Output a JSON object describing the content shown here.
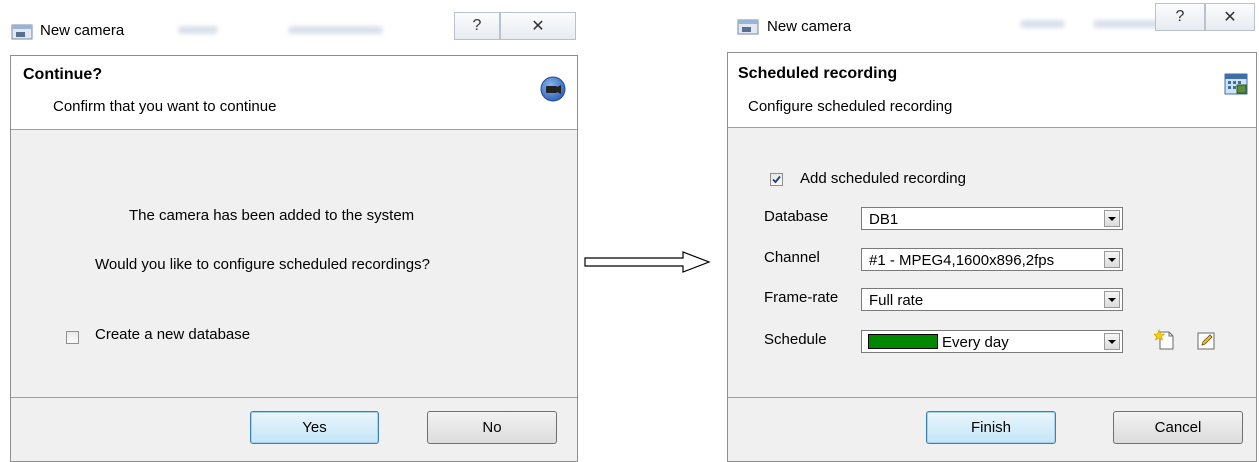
{
  "left_dialog": {
    "window_title": "New camera",
    "help_glyph": "?",
    "close_glyph": "✕",
    "header": {
      "title": "Continue?",
      "subtitle": "Confirm that you want to continue",
      "icon": "camera-disc-icon"
    },
    "message_line1": "The camera has been added to the system",
    "message_line2": "Would you like to configure scheduled recordings?",
    "checkbox": {
      "label": "Create a new database",
      "checked": false
    },
    "buttons": {
      "yes": "Yes",
      "no": "No"
    }
  },
  "right_dialog": {
    "window_title": "New camera",
    "help_glyph": "?",
    "close_glyph": "✕",
    "header": {
      "title": "Scheduled recording",
      "subtitle": "Configure scheduled recording",
      "icon": "calendar-film-icon"
    },
    "add_checkbox": {
      "label": "Add scheduled recording",
      "checked": true
    },
    "fields": {
      "database": {
        "label": "Database",
        "value": "DB1"
      },
      "channel": {
        "label": "Channel",
        "value": "#1 - MPEG4,1600x896,2fps"
      },
      "framerate": {
        "label": "Frame-rate",
        "value": "Full rate"
      },
      "schedule": {
        "label": "Schedule",
        "value": "Every day",
        "swatch_color": "#008800"
      }
    },
    "buttons": {
      "finish": "Finish",
      "cancel": "Cancel"
    }
  },
  "flow_arrow": "arrow-right-icon"
}
